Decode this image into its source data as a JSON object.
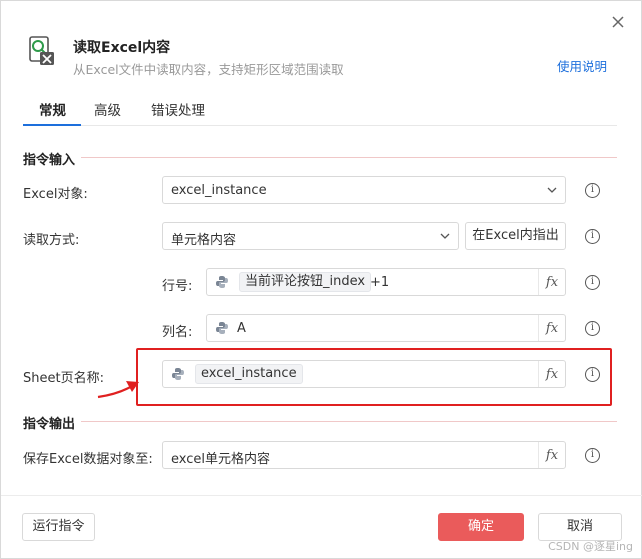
{
  "dialog": {
    "title": "读取Excel内容",
    "subtitle": "从Excel文件中读取内容，支持矩形区域范围读取",
    "help_link": "使用说明"
  },
  "tabs": [
    {
      "label": "常规",
      "active": true
    },
    {
      "label": "高级",
      "active": false
    },
    {
      "label": "错误处理",
      "active": false
    }
  ],
  "input_section": {
    "title": "指令输入",
    "excel_object": {
      "label": "Excel对象:",
      "value": "excel_instance"
    },
    "read_mode": {
      "label": "读取方式:",
      "value": "单元格内容",
      "pick_button": "在Excel内指出"
    },
    "row": {
      "label": "行号:",
      "expr_chip": "当前评论按钮_index",
      "expr_suffix": "+1"
    },
    "column": {
      "label": "列名:",
      "value": "A"
    },
    "sheet_name": {
      "label": "Sheet页名称:",
      "expr_chip": "excel_instance"
    }
  },
  "output_section": {
    "title": "指令输出",
    "save_to": {
      "label": "保存Excel数据对象至:",
      "value": "excel单元格内容"
    }
  },
  "footer": {
    "run_button": "运行指令",
    "ok_button": "确定",
    "cancel_button": "取消"
  },
  "icons": {
    "fx_label": "fx",
    "info_label": "i"
  },
  "watermark": "CSDN @逐星ing",
  "colors": {
    "accent": "#1d6fdc",
    "primary_button": "#ea5b5b",
    "highlight": "#e02020"
  }
}
